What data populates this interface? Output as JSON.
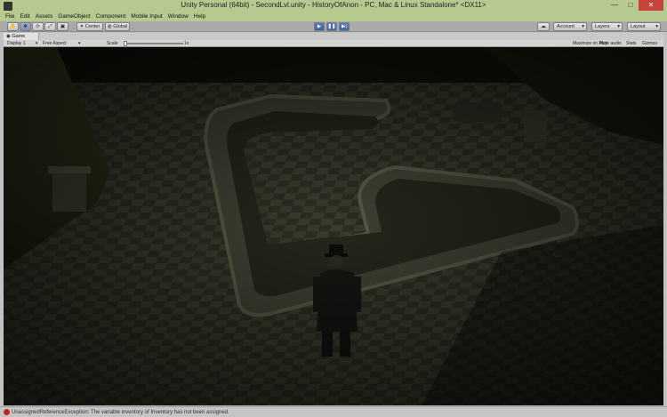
{
  "window": {
    "title": "Unity Personal (64bit) - SecondLvl.unity - HistoryOfAnon - PC, Mac & Linux Standalone* <DX11>",
    "min_glyph": "—",
    "max_glyph": "□",
    "close_glyph": "✕"
  },
  "menu": [
    "File",
    "Edit",
    "Assets",
    "GameObject",
    "Component",
    "Mobile Input",
    "Window",
    "Help"
  ],
  "toolbar": {
    "tool_glyphs": [
      "✋",
      "✥",
      "⟳",
      "⤢",
      "▣"
    ],
    "pivot_label": "Center",
    "space_label": "Global",
    "play_glyph": "▶",
    "pause_glyph": "❚❚",
    "step_glyph": "▶|",
    "cloud_glyph": "☁",
    "account_label": "Account",
    "layers_label": "Layers",
    "layout_label": "Layout"
  },
  "game_view": {
    "tab_label": "Game",
    "display_label": "Display 1",
    "aspect_label": "Free Aspect",
    "scale_label": "Scale",
    "scale_value": "1x",
    "maximize_label": "Maximize on Play",
    "mute_label": "Mute audio",
    "stats_label": "Stats",
    "gizmos_label": "Gizmos"
  },
  "status": {
    "message": "UnassignedReferenceException: The variable inventory of Inventory has not been assigned."
  },
  "colors": {
    "title_bar": "#b6c98f",
    "toolbar": "#a9a9a9",
    "play_active": "#4a6db0",
    "error": "#c82222"
  }
}
